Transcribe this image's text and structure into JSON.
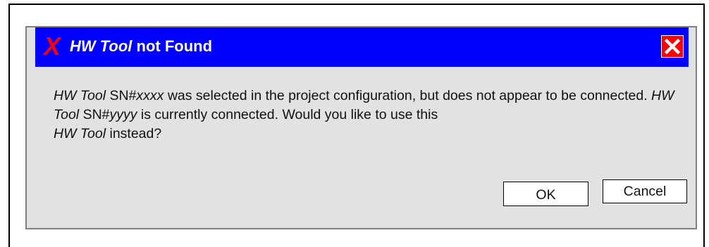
{
  "dialog": {
    "icon": "red-x-icon",
    "title_italic": "HW Tool",
    "title_rest": " not Found",
    "close_icon": "close-icon",
    "message": {
      "p1_italic": "HW Tool",
      "p2": " SN#",
      "p3_italic": "xxxx",
      "p4": " was selected in the project configuration, but does not appear to be connected. ",
      "p5_italic": "HW Tool",
      "p6": " SN#",
      "p7_italic": "yyyy",
      "p8": " is currently connected. Would you like to use this ",
      "p9_italic": "HW Tool",
      "p10": " instead?"
    },
    "buttons": {
      "ok_label": "OK",
      "cancel_label": "Cancel"
    }
  },
  "colors": {
    "titlebar": "#0000ff",
    "title_text": "#ffffff",
    "error_icon": "#ff0000",
    "close_button": "#ff0000",
    "dialog_background": "#e2e2e2"
  }
}
